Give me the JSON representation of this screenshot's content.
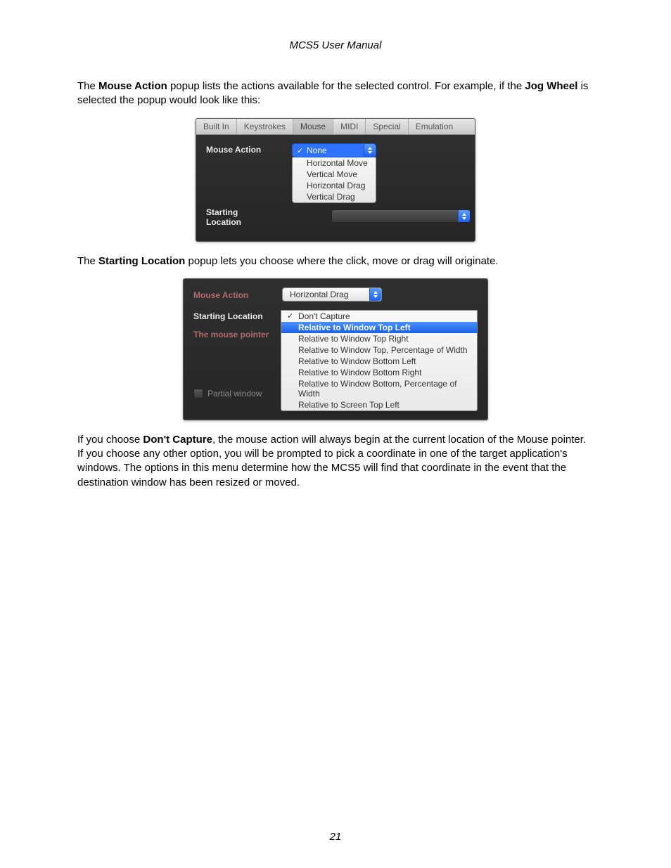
{
  "doc_title": "MCS5 User Manual",
  "para1_prefix": "The ",
  "para1_bold1": "Mouse Action",
  "para1_mid": " popup lists the actions available for the selected control. For example, if the ",
  "para1_bold2": "Jog Wheel",
  "para1_suffix": " is selected the popup would look like this:",
  "shot1": {
    "tabs": {
      "builtin": "Built In",
      "keystrokes": "Keystrokes",
      "mouse": "Mouse",
      "midi": "MIDI",
      "special": "Special",
      "emulation": "Emulation"
    },
    "labels": {
      "mouse_action": "Mouse Action",
      "starting_location": "Starting Location"
    },
    "popup": {
      "selected": "None",
      "items": {
        "horizontal_move": "Horizontal Move",
        "vertical_move": "Vertical Move",
        "horizontal_drag": "Horizontal Drag",
        "vertical_drag": "Vertical Drag"
      }
    }
  },
  "para2_prefix": "The ",
  "para2_bold": "Starting Location",
  "para2_suffix": " popup lets you choose where the click, move or drag will originate.",
  "shot2": {
    "labels": {
      "mouse_action": "Mouse Action",
      "starting_location": "Starting Location",
      "mouse_pointer": "The mouse pointer",
      "partial_window": "Partial window"
    },
    "mouse_action_value": "Horizontal Drag",
    "list": {
      "dont_capture": "Don't Capture",
      "rel_top_left": "Relative to Window Top Left",
      "rel_top_right": "Relative to Window Top Right",
      "rel_top_pct": "Relative to Window Top, Percentage of Width",
      "rel_bottom_left": "Relative to Window Bottom Left",
      "rel_bottom_right": "Relative to Window Bottom Right",
      "rel_bottom_pct": "Relative to Window Bottom, Percentage of Width",
      "rel_screen_top_left": "Relative to Screen Top Left"
    }
  },
  "para3_prefix": "If you choose ",
  "para3_bold": "Don't Capture",
  "para3_suffix": ", the mouse action will always begin at the current location of the Mouse pointer. If you choose any other option, you will be prompted to pick a coordinate in one of the target application's windows. The options in this menu determine how the MCS5 will find that coordinate in the event that the destination window has been resized or moved.",
  "page_number": "21"
}
